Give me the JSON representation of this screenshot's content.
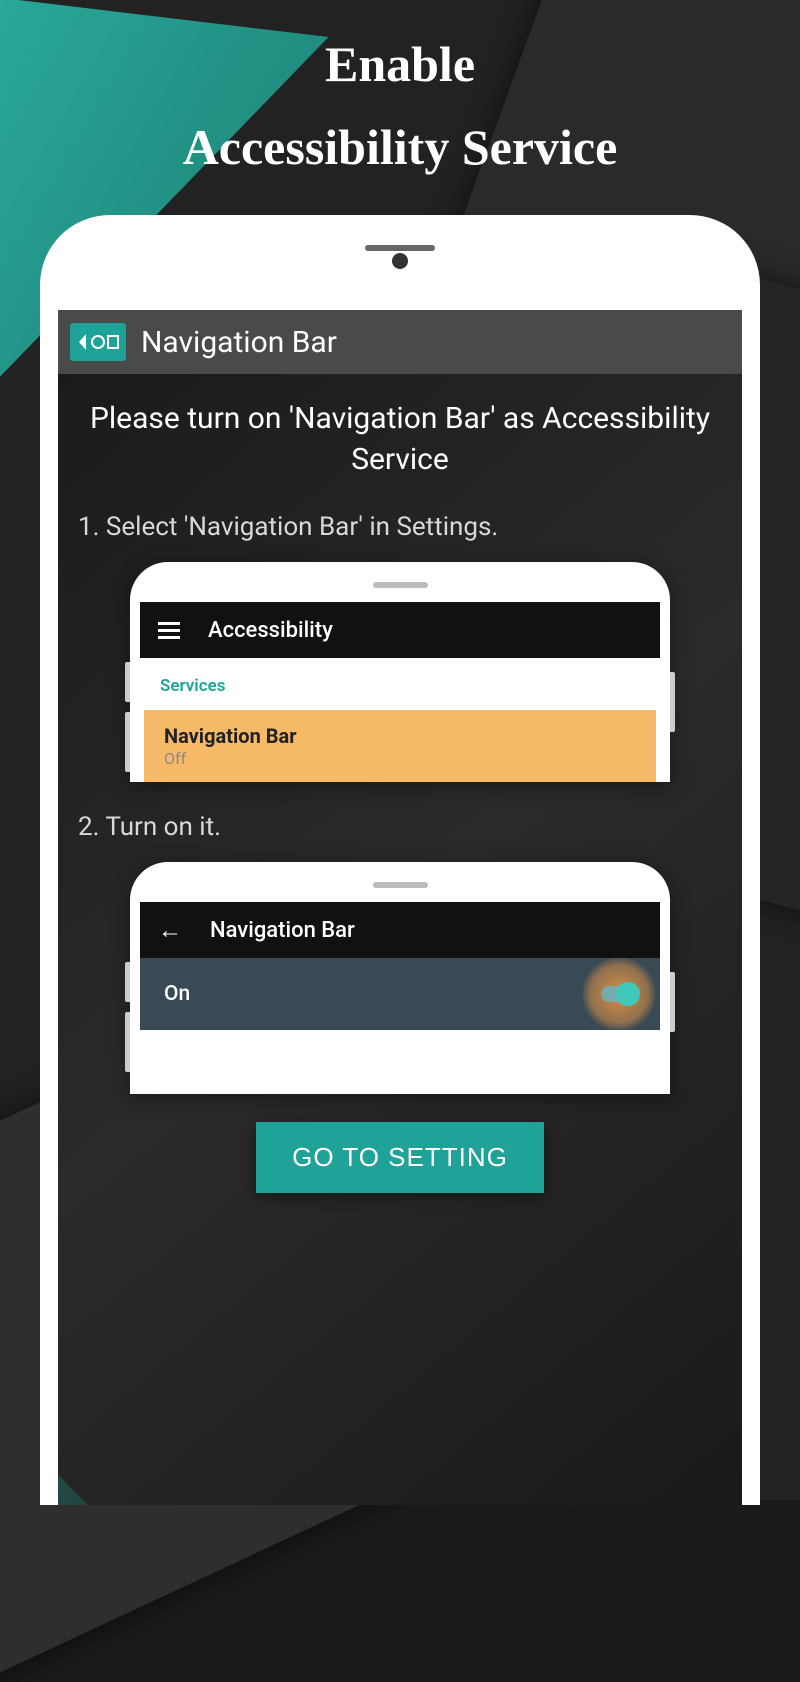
{
  "header": {
    "line1": "Enable",
    "line2": "Accessibility Service"
  },
  "topbar": {
    "title": "Navigation Bar"
  },
  "instruction": "Please turn on 'Navigation Bar' as Accessibility Service",
  "steps": {
    "s1": "1. Select 'Navigation Bar' in Settings.",
    "s2": "2. Turn on it."
  },
  "mini1": {
    "header": "Accessibility",
    "section": "Services",
    "item": "Navigation Bar",
    "status": "Off"
  },
  "mini2": {
    "header": "Navigation Bar",
    "toggle": "On"
  },
  "button": "GO TO SETTING"
}
